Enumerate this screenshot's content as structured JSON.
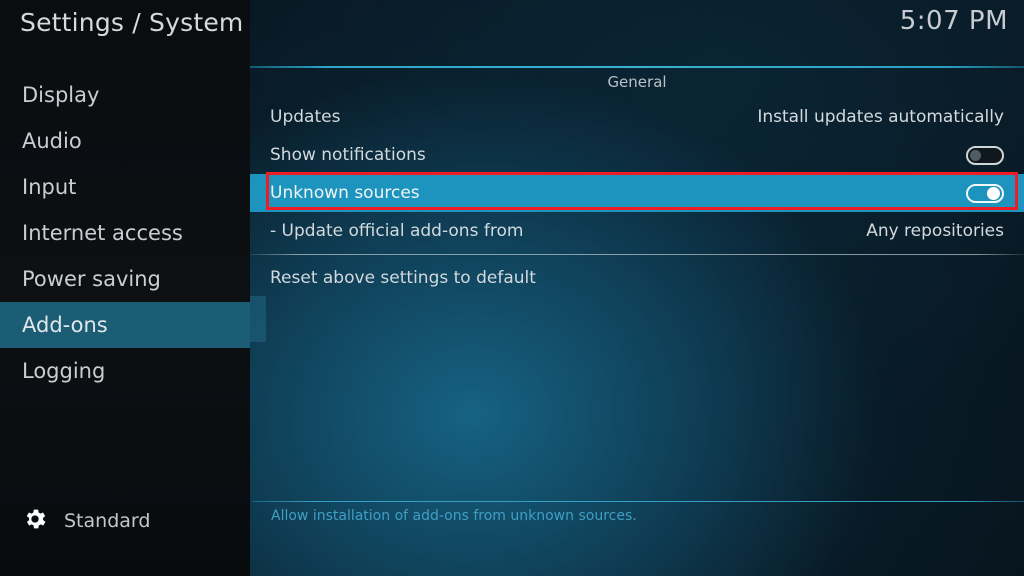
{
  "header": {
    "title": "Settings / System",
    "clock": "5:07 PM"
  },
  "sidebar": {
    "items": [
      {
        "label": "Display",
        "selected": false
      },
      {
        "label": "Audio",
        "selected": false
      },
      {
        "label": "Input",
        "selected": false
      },
      {
        "label": "Internet access",
        "selected": false
      },
      {
        "label": "Power saving",
        "selected": false
      },
      {
        "label": "Add-ons",
        "selected": true
      },
      {
        "label": "Logging",
        "selected": false
      }
    ],
    "profile": {
      "icon": "gear-icon",
      "label": "Standard"
    }
  },
  "main": {
    "section_title": "General",
    "rows": [
      {
        "label": "Updates",
        "value": "Install updates automatically",
        "control": "text"
      },
      {
        "label": "Show notifications",
        "value": "",
        "control": "toggle",
        "toggle_state": "off"
      },
      {
        "label": "Unknown sources",
        "value": "",
        "control": "toggle",
        "toggle_state": "on",
        "highlighted": true
      },
      {
        "label": "- Update official add-ons from",
        "value": "Any repositories",
        "control": "text"
      },
      {
        "label": "Reset above settings to default",
        "value": "",
        "control": "action"
      }
    ],
    "help_text": "Allow installation of add-ons from unknown sources."
  },
  "annotation": {
    "type": "highlight-rectangle",
    "color": "#ee1c24",
    "targets": "Unknown sources"
  },
  "colors": {
    "accent_highlight": "#1d94bd",
    "sidebar_selected": "#1a5d75",
    "rule_cyan": "#37b4d2",
    "help_text": "#3f9fc4",
    "annotation_red": "#ee1c24",
    "panel_teal": "#11455f"
  }
}
